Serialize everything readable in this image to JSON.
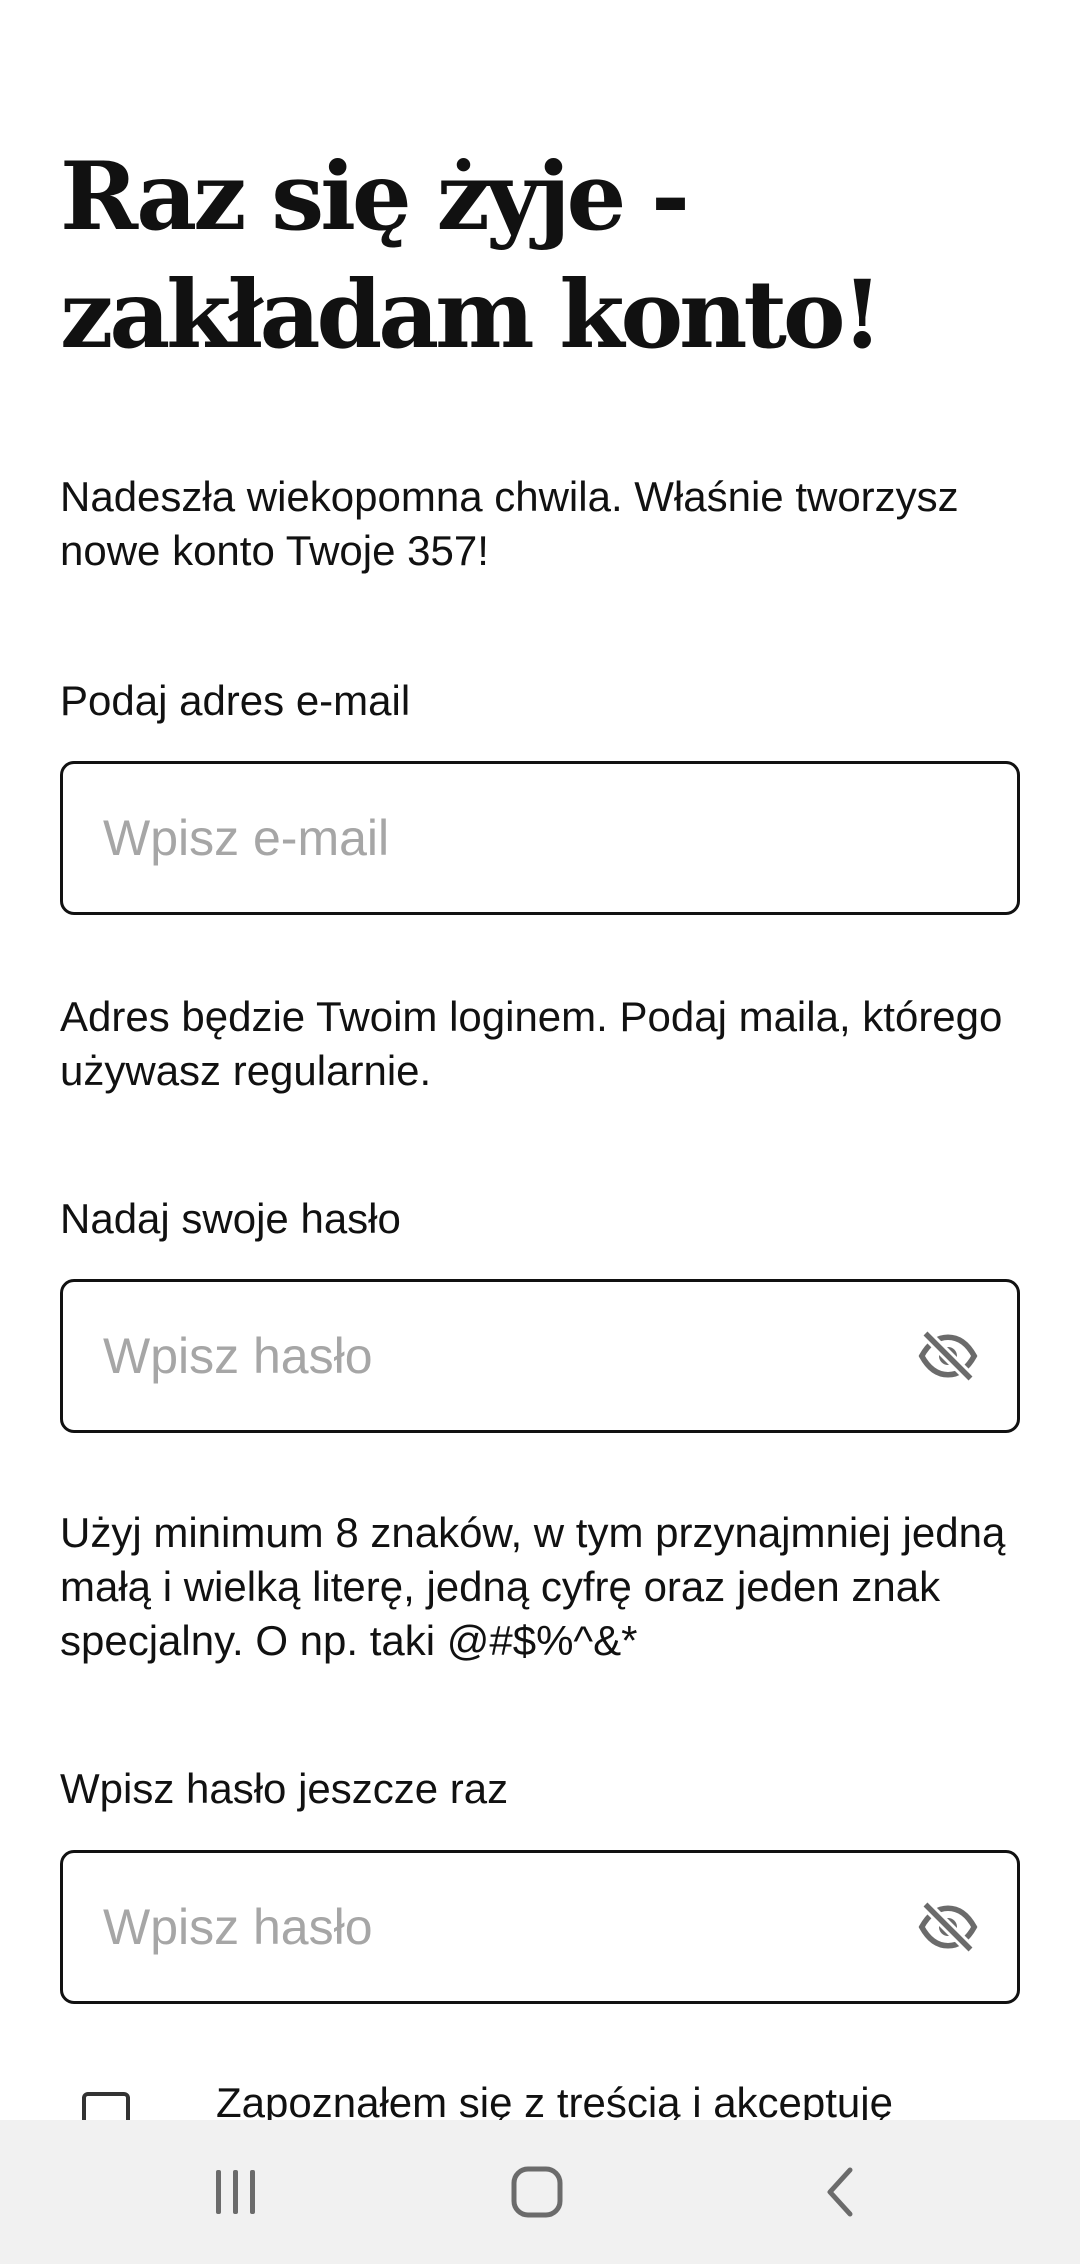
{
  "page": {
    "title": "Raz się żyje - zakładam konto!",
    "intro": "Nadeszła wiekopomna chwila. Właśnie tworzysz nowe konto Twoje 357!"
  },
  "email": {
    "label": "Podaj adres e-mail",
    "placeholder": "Wpisz e-mail",
    "value": "",
    "hint": "Adres będzie Twoim loginem. Podaj maila, którego używasz regularnie."
  },
  "password": {
    "label": "Nadaj swoje hasło",
    "placeholder": "Wpisz hasło",
    "value": "",
    "toggle_icon": "eye-off-icon",
    "hint": "Użyj minimum 8 znaków, w tym przynajmniej jedną małą i wielką literę, jedną cyfrę oraz jeden znak specjalny. O np. taki @#$%^&*"
  },
  "password_confirm": {
    "label": "Wpisz hasło jeszcze raz",
    "placeholder": "Wpisz hasło",
    "value": "",
    "toggle_icon": "eye-off-icon"
  },
  "consent": {
    "label": "Zapoznałem się z treścią i akceptuję",
    "checked": false
  },
  "navbar": {
    "icons": [
      "recent-apps-icon",
      "home-icon",
      "back-icon"
    ]
  },
  "colors": {
    "text": "#111111",
    "placeholder": "#a6a6a6",
    "border": "#111111",
    "navbar_bg": "#f1f1f1",
    "navbar_icon": "#6b6b6b"
  }
}
